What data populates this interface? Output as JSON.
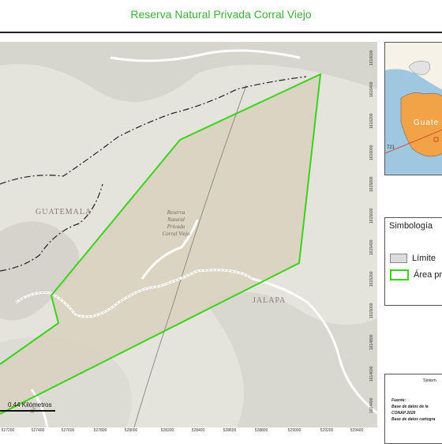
{
  "title": "Reserva Natural Privada Corral Viejo",
  "coords_x": [
    "527200",
    "527400",
    "527600",
    "527800",
    "528000",
    "528200",
    "528400",
    "528600",
    "528800",
    "529000",
    "529200",
    "529400"
  ],
  "coords_y": [
    "1616600",
    "1616400",
    "1616200",
    "1616000",
    "1615800",
    "1615600",
    "1615400",
    "1615200",
    "1615000",
    "1614800",
    "1614600",
    "1614400"
  ],
  "map_labels": {
    "guatemala": "GUATEMALA",
    "jalapa": "JALAPA",
    "reserve": [
      "Reserva",
      "Natural",
      "Privada",
      "Corral Viejo"
    ],
    "road_fragment": "Vie"
  },
  "scale": {
    "label": "0.44 Kilómetros"
  },
  "inset": {
    "country_label": "Guate",
    "number_label": "721"
  },
  "legend": {
    "title": "Simbología",
    "items": [
      {
        "label": "Límite",
        "color": "#dcdcdc",
        "border": "#888888"
      },
      {
        "label": "Área pr",
        "color": "#ffffff",
        "border": "#3bd21b"
      }
    ]
  },
  "info": {
    "system": "Sistem",
    "source_title": "Fuente:",
    "source_line1": "Base de datos de la",
    "source_line2": "CONAP 2026",
    "source_line3": "Base de datos cartogra"
  },
  "colors": {
    "title": "#3fae3a",
    "polygon": "#3bd21b",
    "inset_land": "#f2a347"
  }
}
